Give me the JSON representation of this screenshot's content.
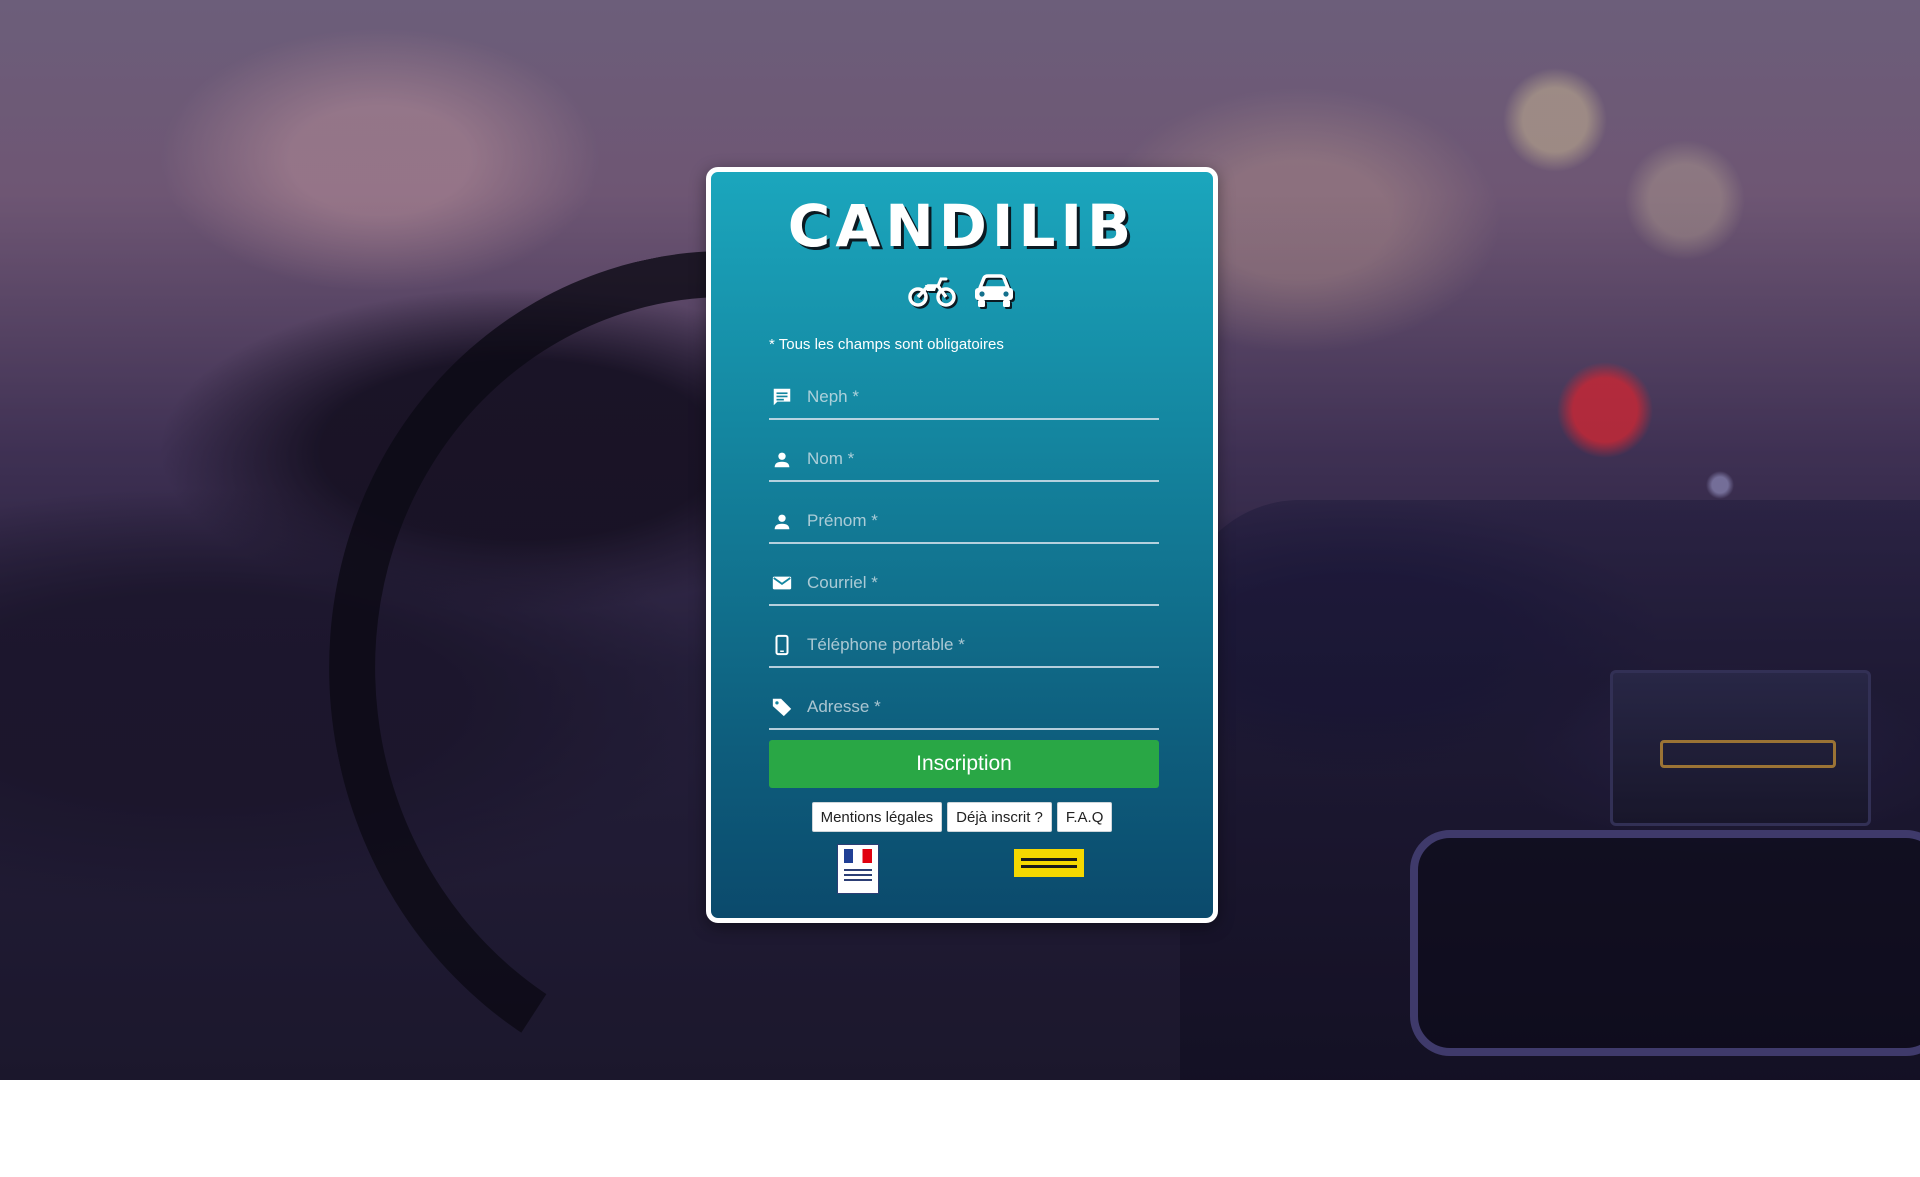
{
  "app": {
    "title": "CANDILIB"
  },
  "header": {
    "vehicle_icons": [
      "motorcycle-icon",
      "car-icon"
    ]
  },
  "form": {
    "required_hint": "* Tous les champs sont obligatoires",
    "fields": [
      {
        "id": "neph",
        "placeholder": "Neph *",
        "value": "",
        "icon": "message-icon"
      },
      {
        "id": "nom",
        "placeholder": "Nom *",
        "value": "",
        "icon": "person-icon"
      },
      {
        "id": "prenom",
        "placeholder": "Prénom *",
        "value": "",
        "icon": "person-icon"
      },
      {
        "id": "courriel",
        "placeholder": "Courriel *",
        "value": "",
        "icon": "mail-icon"
      },
      {
        "id": "telephone",
        "placeholder": "Téléphone portable *",
        "value": "",
        "icon": "phone-icon"
      },
      {
        "id": "adresse",
        "placeholder": "Adresse *",
        "value": "",
        "icon": "tag-icon"
      }
    ],
    "submit_label": "Inscription"
  },
  "footer": {
    "links": [
      "Mentions légales",
      "Déjà inscrit ?",
      "F.A.Q"
    ],
    "logos": [
      "ministere-interieur-logo",
      "securite-routiere-logo"
    ]
  },
  "colors": {
    "card_gradient_top": "#1ba6bd",
    "card_gradient_bottom": "#0b4a6c",
    "submit_button": "#29a745",
    "card_border": "#ffffff"
  }
}
